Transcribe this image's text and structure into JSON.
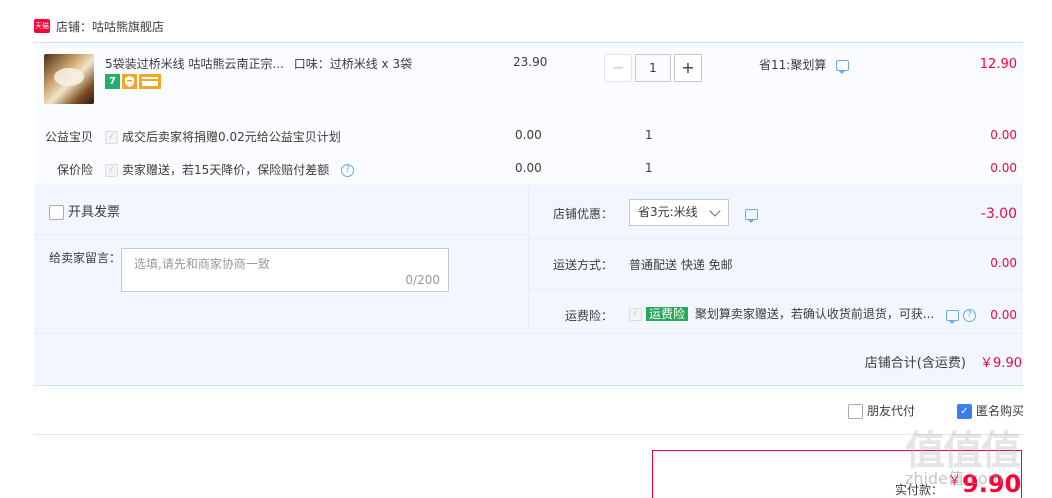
{
  "shop": {
    "badge": "天猫",
    "label": "店铺：咕咕熊旗舰店"
  },
  "item": {
    "title": "5袋装过桥米线 咕咕熊云南正宗...",
    "flavor": "口味：过桥米线 x 3袋",
    "badges": [
      "7",
      "",
      ""
    ],
    "unit_price": "23.90",
    "quantity": "1",
    "minus": "−",
    "plus": "+",
    "promo": "省11:聚划算",
    "subtotal": "12.90"
  },
  "charity": {
    "label": "公益宝贝",
    "text": "成交后卖家将捐赠0.02元给公益宝贝计划",
    "price": "0.00",
    "qty": "1",
    "total": "0.00"
  },
  "price_protect": {
    "label": "保价险",
    "text": "卖家赠送，若15天降价，保险赔付差额",
    "help": "?",
    "price": "0.00",
    "qty": "1",
    "total": "0.00"
  },
  "invoice": {
    "label": "开具发票"
  },
  "note": {
    "label": "给卖家留言：",
    "placeholder": "选填,请先和商家协商一致",
    "count": "0/200"
  },
  "shop_discount": {
    "label": "店铺优惠：",
    "selected": "省3元:米线",
    "amount": "-3.00"
  },
  "shipping": {
    "label": "运送方式：",
    "value": "普通配送 快递 免邮",
    "amount": "0.00"
  },
  "shipping_insurance": {
    "label": "运费险：",
    "tag": "运费险",
    "text": "聚划算卖家赠送，若确认收货前退货，可获...",
    "amount": "0.00"
  },
  "shop_total": {
    "label": "店铺合计(含运费)",
    "amount": "￥9.90"
  },
  "options": {
    "friend_pay": "朋友代付",
    "anonymous": "匿名购买"
  },
  "payment": {
    "label": "实付款：",
    "currency": "￥",
    "amount": "9.90"
  },
  "watermark": {
    "logo": "值值值",
    "site": "zhide值.com"
  },
  "colors": {
    "accent_red": "#ff0036",
    "accent_blue": "#3e7cf2",
    "tag_green": "#2ca659"
  }
}
